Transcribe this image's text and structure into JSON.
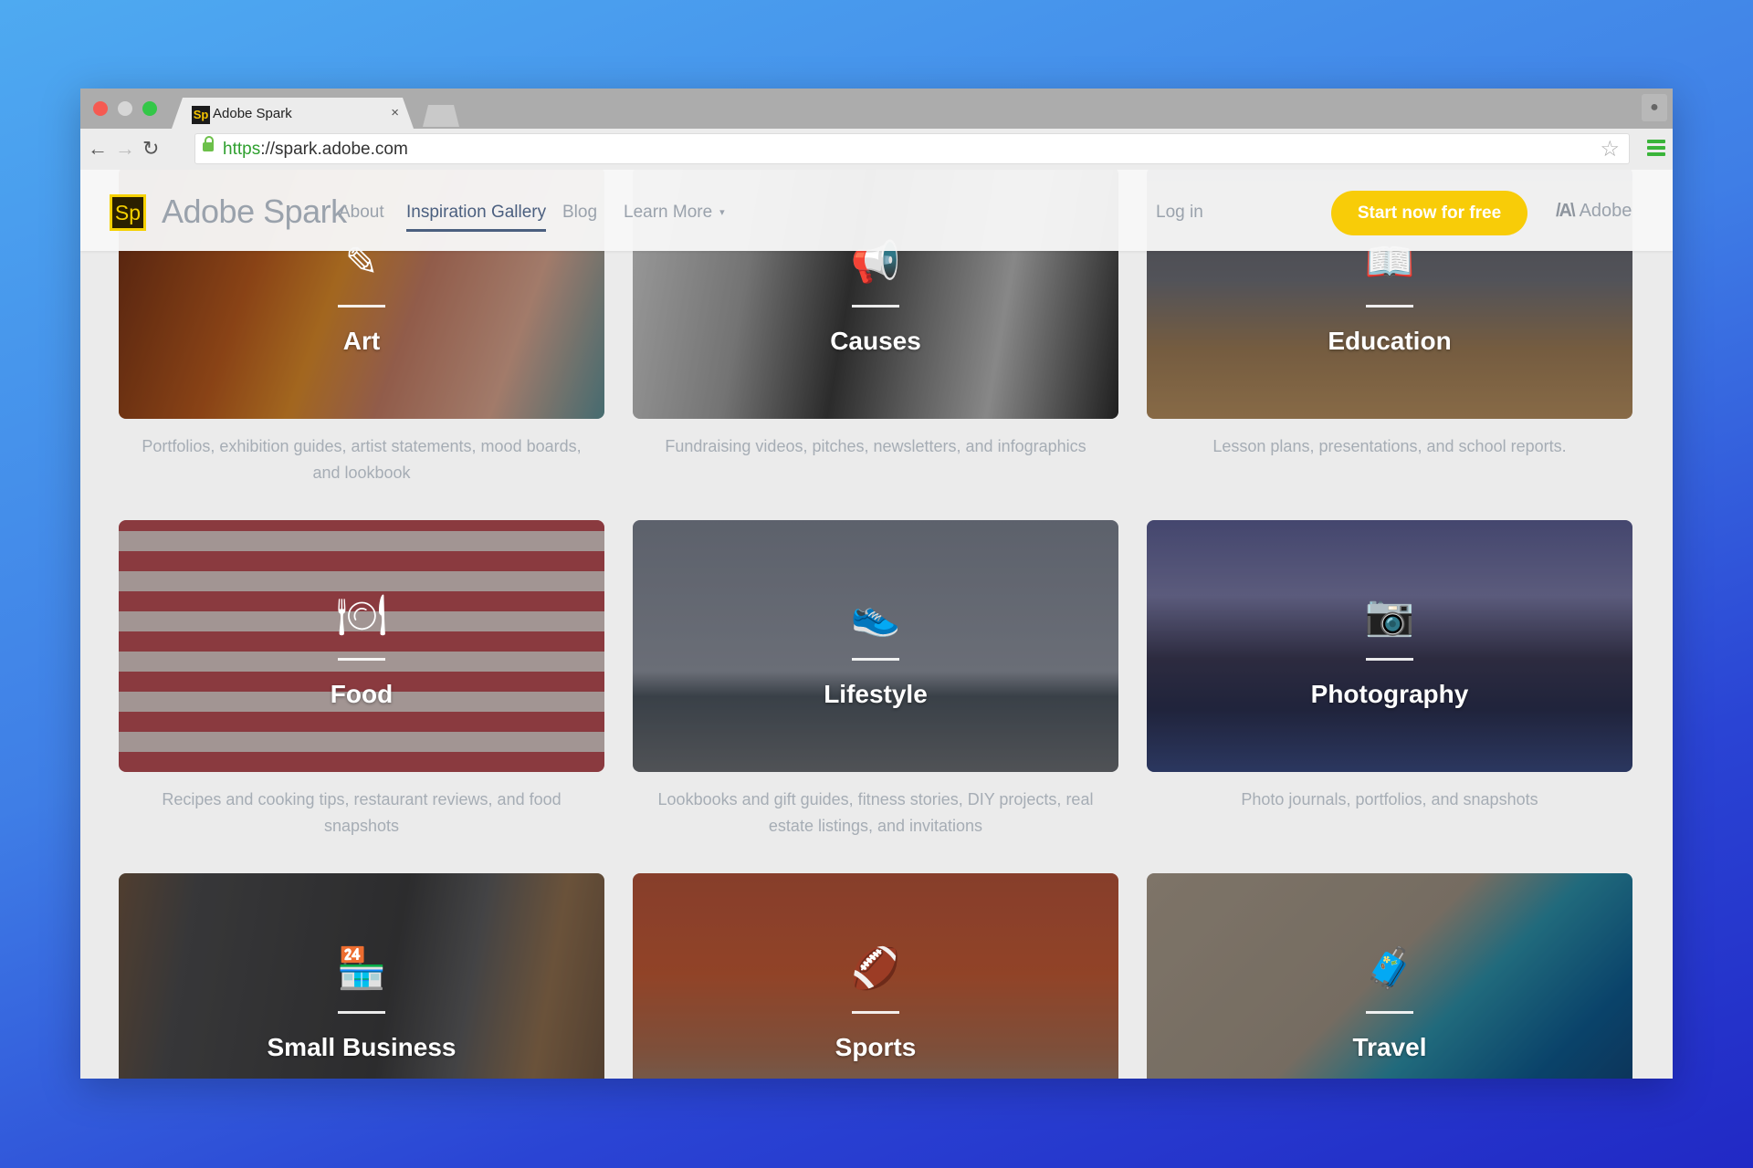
{
  "browser": {
    "tab_title": "Adobe Spark",
    "tab_favicon": "Sp",
    "tab_close": "×",
    "url_scheme": "https",
    "url_rest": "://spark.adobe.com",
    "back_icon": "←",
    "forward_icon": "→",
    "reload_icon": "↻",
    "bookmark_icon": "☆",
    "profile_icon": "👤"
  },
  "site_nav": {
    "logo_mark": "Sp",
    "logo_text": "Adobe Spark",
    "links": [
      {
        "label": "About",
        "active": false
      },
      {
        "label": "Inspiration Gallery",
        "active": true
      },
      {
        "label": "Blog",
        "active": false
      },
      {
        "label": "Learn More",
        "active": false,
        "caret": "▾"
      }
    ],
    "login": "Log in",
    "cta": "Start now for free",
    "adobe_mark": "/A\\",
    "adobe_label": "Adobe"
  },
  "colors": {
    "accent_yellow": "#f8cc08",
    "nav_active": "#4b5f7f",
    "nav_text": "#9aa2ac",
    "caption_text": "#a6adb5",
    "page_bg": "#ebebeb"
  },
  "gallery": [
    {
      "title": "Art",
      "icon": "paintbrush-icon",
      "glyph": "✎",
      "desc": "Portfolios, exhibition guides, artist statements, mood boards, and lookbook",
      "bg": "linear-gradient(110deg,#6a2b14 0%,#b85a1e 30%,#d9892a 45%,#c27b63 60%,#d8a48e 80%,#5d8f95 100%)"
    },
    {
      "title": "Causes",
      "icon": "megaphone-icon",
      "glyph": "📢",
      "desc": "Fundraising videos, pitches, newsletters, and infographics",
      "bg": "linear-gradient(100deg,#cfcfcf 0%,#9a9a9a 25%,#3a3a3a 45%,#7a7a7a 60%,#b5b5b5 75%,#2a2a2a 100%)"
    },
    {
      "title": "Education",
      "icon": "book-icon",
      "glyph": "📖",
      "desc": "Lesson plans, presentations, and school reports.",
      "bg": "linear-gradient(180deg,#5b5b62 0%,#6e6f77 45%,#9c7b56 72%,#b58e5e 100%)"
    },
    {
      "title": "Food",
      "icon": "fork-plate-icon",
      "glyph": "🍽",
      "desc": "Recipes and cooking tips, restaurant reviews, and food snapshots",
      "bg": "repeating-linear-gradient(0deg,#b84e55 0 22px,#d9c7c4 22px 44px),#b84e55"
    },
    {
      "title": "Lifestyle",
      "icon": "sneaker-icon",
      "glyph": "👟",
      "desc": "Lookbooks and gift guides, fitness stories, DIY projects, real estate listings, and invitations",
      "bg": "linear-gradient(180deg,#7c8290 0%,#8e939f 60%,#4d5660 70%,#6b6e73 100%)"
    },
    {
      "title": "Photography",
      "icon": "camera-icon",
      "glyph": "📷",
      "desc": "Photo journals, portfolios, and snapshots",
      "bg": "linear-gradient(180deg,#5b5e93 0%,#7a7aa6 30%,#3c3a55 55%,#2b3050 75%,#3a4a80 100%)"
    },
    {
      "title": "Small Business",
      "icon": "storefront-icon",
      "glyph": "🏪",
      "desc": "",
      "bg": "linear-gradient(100deg,#6b5340 0%,#4a4a4c 15%,#3b3b3d 55%,#5a5a5c 70%,#8e6e4e 85%,#6b5340 100%)"
    },
    {
      "title": "Sports",
      "icon": "football-icon",
      "glyph": "🏈",
      "desc": "",
      "bg": "linear-gradient(180deg,#b4533a 0%,#c25a35 40%,#a86a4e 70%,#8d8a7e 100%)"
    },
    {
      "title": "Travel",
      "icon": "suitcase-icon",
      "glyph": "🧳",
      "desc": "",
      "bg": "linear-gradient(135deg,#a89b8b 0%,#9d9182 45%,#2c8ea6 60%,#0e5a8e 80%,#123f70 100%)"
    }
  ]
}
